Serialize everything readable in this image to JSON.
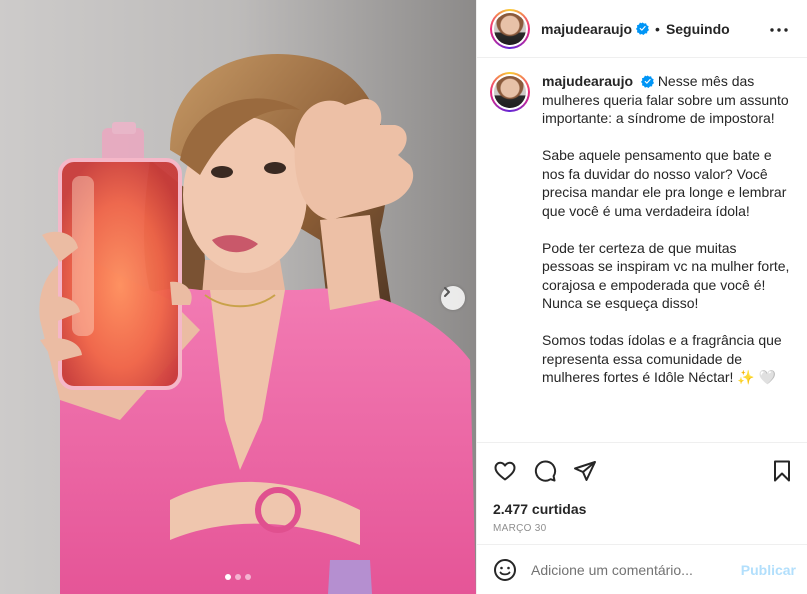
{
  "post": {
    "username": "majudearaujo",
    "follow_status": "Seguindo",
    "separator": "•",
    "caption": {
      "username": "majudearaujo",
      "first_line": "Nesse mês das mulheres queria falar sobre um assunto importante: a síndrome de impostora!",
      "paragraphs": [
        "Sabe aquele pensamento que bate e nos fa duvidar do nosso valor? Você precisa mandar ele pra longe e lembrar que você é uma verdadeira ídola!",
        "Pode ter certeza de que muitas pessoas se inspiram vc na mulher forte, corajosa e empoderada que você é! Nunca se esqueça disso!",
        "Somos todas ídolas e a fragrância que representa essa comunidade de mulheres fortes é Idôle Néctar! ✨ 🤍"
      ]
    },
    "likes": "2.477 curtidas",
    "date": "MARÇO 30",
    "comment": {
      "placeholder": "Adicione um comentário...",
      "publish_label": "Publicar"
    },
    "carousel": {
      "count": 3,
      "active_index": 0
    }
  },
  "icons": {
    "verified": "verified-badge-icon",
    "more": "more-options-icon",
    "like": "heart-icon",
    "comment": "comment-icon",
    "share": "share-icon",
    "save": "bookmark-icon",
    "emoji": "emoji-icon",
    "next": "chevron-right-icon"
  },
  "colors": {
    "verified": "#0095f6",
    "publish_disabled": "#b2dffc",
    "blouse": "#f06aa8"
  }
}
